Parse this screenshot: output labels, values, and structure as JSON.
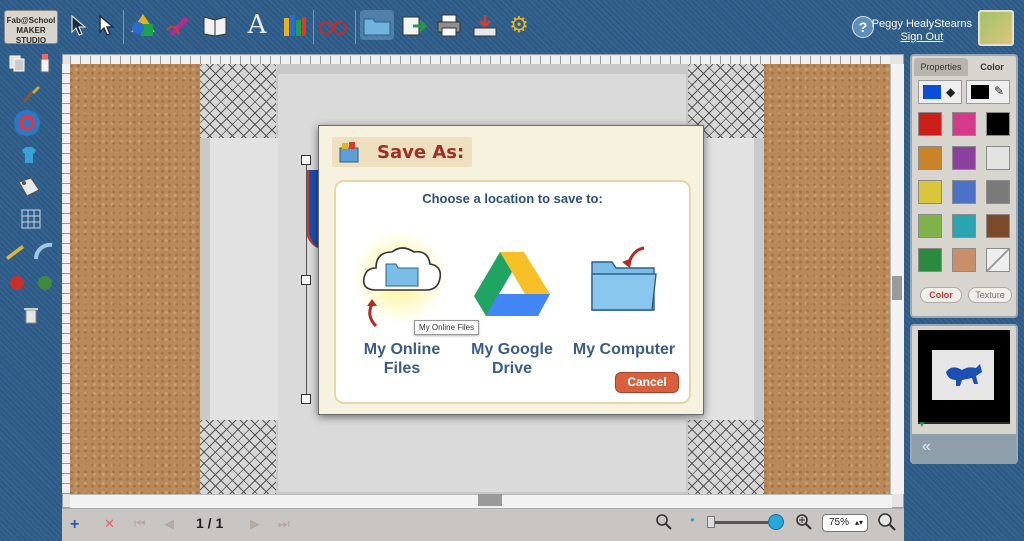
{
  "app": {
    "logo_line1": "Fab@School",
    "logo_line2": "MAKER STUDIO"
  },
  "user": {
    "name": "Peggy HealyStearns",
    "signout": "Sign Out",
    "help": "?"
  },
  "toolbar": {
    "icons": [
      "select-arrow-icon",
      "direct-select-icon",
      "shapes-icon",
      "pen-icon",
      "book-icon",
      "text-icon",
      "library-icon",
      "glasses-icon",
      "folder-icon",
      "import-icon",
      "print-icon",
      "send-to-cutter-icon",
      "settings-icon"
    ]
  },
  "bottom": {
    "page_indicator": "1 / 1",
    "zoom": "75%"
  },
  "right_panel": {
    "tab_properties": "Properties",
    "tab_color": "Color",
    "pill_color": "Color",
    "pill_texture": "Texture",
    "fill_color": "#0b4ed6",
    "stroke_color": "#000000",
    "swatches": [
      "#cc1f1a",
      "#d63a8a",
      "#000000",
      "#c9842a",
      "#8b3f9e",
      "#e3e3e3",
      "#d9c63a",
      "#4b72c7",
      "#7a7a7a",
      "#7fb24b",
      "#2aa3b3",
      "#7a4a2a",
      "#2b8a3e",
      "#c98e6a",
      "none"
    ],
    "preview_collapse": "«"
  },
  "dialog": {
    "title": "Save As:",
    "prompt": "Choose a location to save to:",
    "option1_line1": "My Online",
    "option1_line2": "Files",
    "option2_line1": "My Google",
    "option2_line2": "Drive",
    "option3": "My Computer",
    "tooltip": "My Online Files",
    "cancel": "Cancel"
  }
}
